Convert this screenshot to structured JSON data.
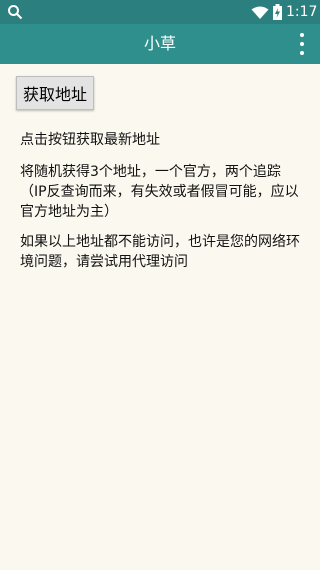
{
  "status_bar": {
    "time": "1:17",
    "icons": [
      "search-icon",
      "wifi-icon",
      "battery-charging-icon"
    ]
  },
  "app_bar": {
    "title": "小草",
    "overflow_icon": "more-vert-icon"
  },
  "main": {
    "get_address_button": "获取地址",
    "paragraphs": [
      "点击按钮获取最新地址",
      "将随机获得3个地址，一个官方，两个追踪（IP反查询而来，有失效或者假冒可能，应以官方地址为主）",
      "如果以上地址都不能访问，也许是您的网络环境问题，请尝试用代理访问"
    ]
  },
  "colors": {
    "status_bar": "#2b7f7e",
    "app_bar": "#2f8f8c",
    "background": "#fbf8ef",
    "button": "#e3e3e3"
  }
}
